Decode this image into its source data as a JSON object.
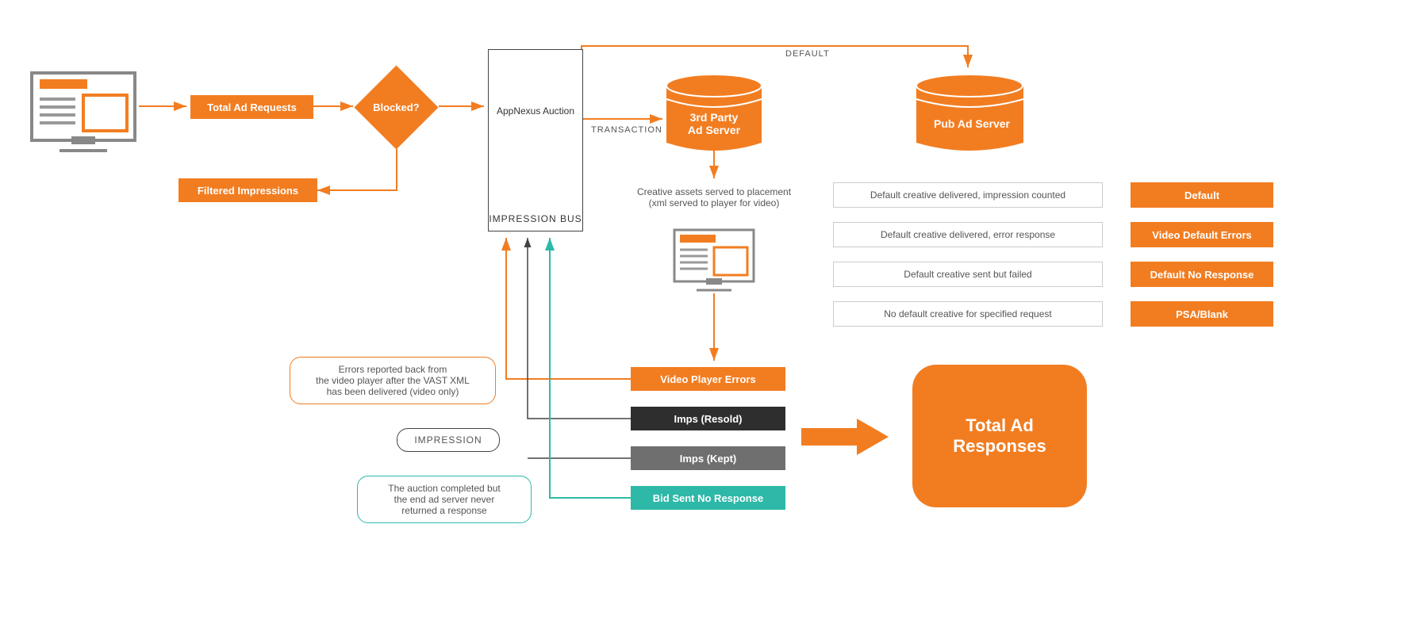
{
  "nodes": {
    "total_ad_requests": "Total Ad Requests",
    "blocked": "Blocked?",
    "filtered_impressions": "Filtered Impressions",
    "appnexus_auction": "AppNexus Auction",
    "impression_bus": "IMPRESSION BUS",
    "third_party_ad_server": "3rd Party\nAd Server",
    "pub_ad_server": "Pub Ad Server",
    "creative_assets_note": "Creative assets served to placement\n(xml served to player for video)",
    "video_player_errors": "Video Player Errors",
    "imps_resold": "Imps (Resold)",
    "imps_kept": "Imps (Kept)",
    "bid_sent_no_response": "Bid Sent No Response",
    "total_ad_responses": "Total Ad\nResponses",
    "pub_rows": [
      "Default creative delivered, impression counted",
      "Default creative delivered, error response",
      "Default creative sent but failed",
      "No default creative for specified request"
    ],
    "pub_tags": [
      "Default",
      "Video Default Errors",
      "Default No Response",
      "PSA/Blank"
    ]
  },
  "edges": {
    "transaction": "TRANSACTION",
    "default": "DEFAULT"
  },
  "callouts": {
    "errors_note": "Errors reported back from\nthe video player after the VAST XML\nhas been delivered (video only)",
    "impression_note": "IMPRESSION",
    "auction_note": "The auction completed but\nthe end ad server never\nreturned a response"
  }
}
